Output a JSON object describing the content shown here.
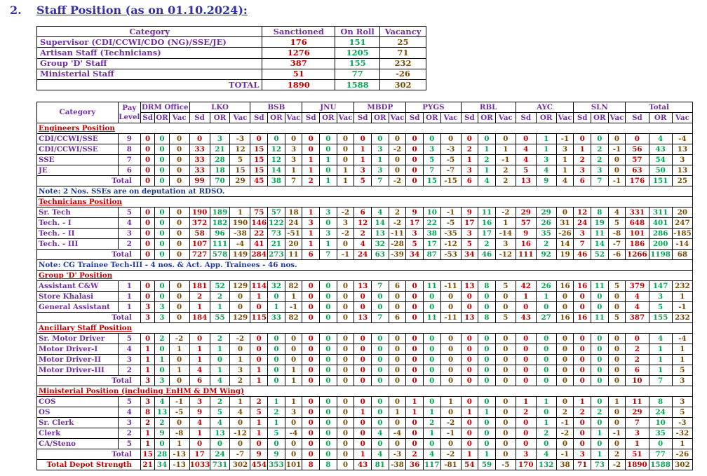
{
  "heading": {
    "number": "2.",
    "title": "Staff Position (as on 01.10.2024):"
  },
  "summary": {
    "headers": [
      "Category",
      "Sanctioned",
      "On Roll",
      "Vacancy"
    ],
    "rows": [
      {
        "category": "Supervisor (CDI/CCWI/CDO (NG)/SSE/JE)",
        "sanctioned": "176",
        "on_roll": "151",
        "vacancy": "25"
      },
      {
        "category": "Artisan Staff (Technicians)",
        "sanctioned": "1276",
        "on_roll": "1205",
        "vacancy": "71"
      },
      {
        "category": "Group 'D' Staff",
        "sanctioned": "387",
        "on_roll": "155",
        "vacancy": "232"
      },
      {
        "category": "Ministerial Staff",
        "sanctioned": "51",
        "on_roll": "77",
        "vacancy": "-26"
      }
    ],
    "total": {
      "label": "TOTAL",
      "sanctioned": "1890",
      "on_roll": "1588",
      "vacancy": "302"
    }
  },
  "detail": {
    "category_header": "Category",
    "pay_level_header": "Pay Level",
    "locations": [
      "DRM Office",
      "LKO",
      "BSB",
      "JNU",
      "MBDP",
      "PYGS",
      "RBL",
      "AYC",
      "SLN",
      "Total"
    ],
    "sub_headers": [
      "Sd",
      "OR",
      "Vac"
    ],
    "rows": [
      {
        "type": "section",
        "label": "Engineers Position"
      },
      {
        "type": "data",
        "label": "CDI/CCWI/SSE",
        "pay": "9",
        "values": [
          "0",
          "0",
          "0",
          "0",
          "3",
          "-3",
          "0",
          "0",
          "0",
          "0",
          "0",
          "0",
          "0",
          "0",
          "0",
          "0",
          "0",
          "0",
          "0",
          "0",
          "0",
          "0",
          "1",
          "-1",
          "0",
          "0",
          "0",
          "0",
          "4",
          "-4"
        ]
      },
      {
        "type": "data",
        "label": "CDI/CCWI/SSE",
        "pay": "8",
        "values": [
          "0",
          "0",
          "0",
          "33",
          "21",
          "12",
          "15",
          "12",
          "3",
          "0",
          "0",
          "0",
          "1",
          "3",
          "-2",
          "0",
          "3",
          "-3",
          "2",
          "1",
          "1",
          "4",
          "1",
          "3",
          "1",
          "2",
          "-1",
          "56",
          "43",
          "13"
        ]
      },
      {
        "type": "data",
        "label": "SSE",
        "pay": "7",
        "values": [
          "0",
          "0",
          "0",
          "33",
          "28",
          "5",
          "15",
          "12",
          "3",
          "1",
          "1",
          "0",
          "1",
          "1",
          "0",
          "0",
          "5",
          "-5",
          "1",
          "2",
          "-1",
          "4",
          "3",
          "1",
          "2",
          "2",
          "0",
          "57",
          "54",
          "3"
        ]
      },
      {
        "type": "data",
        "label": "JE",
        "pay": "6",
        "values": [
          "0",
          "0",
          "0",
          "33",
          "18",
          "15",
          "15",
          "14",
          "1",
          "1",
          "0",
          "1",
          "3",
          "3",
          "0",
          "0",
          "7",
          "-7",
          "3",
          "1",
          "2",
          "5",
          "4",
          "1",
          "3",
          "3",
          "0",
          "63",
          "50",
          "13"
        ]
      },
      {
        "type": "total",
        "label": "Total",
        "values": [
          "0",
          "0",
          "0",
          "99",
          "70",
          "29",
          "45",
          "38",
          "7",
          "2",
          "1",
          "1",
          "5",
          "7",
          "-2",
          "0",
          "15",
          "-15",
          "6",
          "4",
          "2",
          "13",
          "9",
          "4",
          "6",
          "7",
          "-1",
          "176",
          "151",
          "25"
        ]
      },
      {
        "type": "note",
        "label": "Note: 2 Nos. SSEs are on deputation at RDSO."
      },
      {
        "type": "section",
        "label": "Technicians Position"
      },
      {
        "type": "data",
        "label": "Sr. Tech",
        "pay": "5",
        "values": [
          "0",
          "0",
          "0",
          "190",
          "189",
          "1",
          "75",
          "57",
          "18",
          "1",
          "3",
          "-2",
          "6",
          "4",
          "2",
          "9",
          "10",
          "-1",
          "9",
          "11",
          "-2",
          "29",
          "29",
          "0",
          "12",
          "8",
          "4",
          "331",
          "311",
          "20"
        ]
      },
      {
        "type": "data",
        "label": "Tech. - I",
        "pay": "4",
        "values": [
          "0",
          "0",
          "0",
          "372",
          "182",
          "190",
          "146",
          "122",
          "24",
          "3",
          "0",
          "3",
          "12",
          "14",
          "-2",
          "17",
          "22",
          "-5",
          "17",
          "16",
          "1",
          "57",
          "26",
          "31",
          "24",
          "19",
          "5",
          "648",
          "401",
          "247"
        ]
      },
      {
        "type": "data",
        "label": "Tech. - II",
        "pay": "3",
        "values": [
          "0",
          "0",
          "0",
          "58",
          "96",
          "-38",
          "22",
          "73",
          "-51",
          "1",
          "3",
          "-2",
          "2",
          "13",
          "-11",
          "3",
          "38",
          "-35",
          "3",
          "17",
          "-14",
          "9",
          "35",
          "-26",
          "3",
          "11",
          "-8",
          "101",
          "286",
          "-185"
        ]
      },
      {
        "type": "data",
        "label": "Tech. - III",
        "pay": "2",
        "values": [
          "0",
          "0",
          "0",
          "107",
          "111",
          "-4",
          "41",
          "21",
          "20",
          "1",
          "1",
          "0",
          "4",
          "32",
          "-28",
          "5",
          "17",
          "-12",
          "5",
          "2",
          "3",
          "16",
          "2",
          "14",
          "7",
          "14",
          "-7",
          "186",
          "200",
          "-14"
        ]
      },
      {
        "type": "total",
        "label": "Total",
        "values": [
          "0",
          "0",
          "0",
          "727",
          "578",
          "149",
          "284",
          "273",
          "11",
          "6",
          "7",
          "-1",
          "24",
          "63",
          "-39",
          "34",
          "87",
          "-53",
          "34",
          "46",
          "-12",
          "111",
          "92",
          "19",
          "46",
          "52",
          "-6",
          "1266",
          "1198",
          "68"
        ]
      },
      {
        "type": "note",
        "label": "Note: CG Trainee Tech-III - 4 nos. & Act. App. Trainees - 46 nos."
      },
      {
        "type": "section",
        "label": "Group 'D' Position"
      },
      {
        "type": "data",
        "label": "Assistant C&W",
        "pay": "1",
        "values": [
          "0",
          "0",
          "0",
          "181",
          "52",
          "129",
          "114",
          "32",
          "82",
          "0",
          "0",
          "0",
          "13",
          "7",
          "6",
          "0",
          "11",
          "-11",
          "13",
          "8",
          "5",
          "42",
          "26",
          "16",
          "16",
          "11",
          "5",
          "379",
          "147",
          "232"
        ]
      },
      {
        "type": "data",
        "label": "Store Khalasi",
        "pay": "1",
        "values": [
          "0",
          "0",
          "0",
          "2",
          "2",
          "0",
          "1",
          "0",
          "1",
          "0",
          "0",
          "0",
          "0",
          "0",
          "0",
          "0",
          "0",
          "0",
          "0",
          "0",
          "0",
          "1",
          "1",
          "0",
          "0",
          "0",
          "0",
          "4",
          "3",
          "1"
        ]
      },
      {
        "type": "data",
        "label": "General Assistant",
        "pay": "1",
        "values": [
          "3",
          "3",
          "0",
          "1",
          "1",
          "0",
          "0",
          "1",
          "-1",
          "0",
          "0",
          "0",
          "0",
          "0",
          "0",
          "0",
          "0",
          "0",
          "0",
          "0",
          "0",
          "0",
          "0",
          "0",
          "0",
          "0",
          "0",
          "4",
          "5",
          "-1"
        ]
      },
      {
        "type": "total",
        "label": "Total",
        "values": [
          "3",
          "3",
          "0",
          "184",
          "55",
          "129",
          "115",
          "33",
          "82",
          "0",
          "0",
          "0",
          "13",
          "7",
          "6",
          "0",
          "11",
          "-11",
          "13",
          "8",
          "5",
          "43",
          "27",
          "16",
          "16",
          "11",
          "5",
          "387",
          "155",
          "232"
        ]
      },
      {
        "type": "section",
        "label": "Ancillary Staff Position"
      },
      {
        "type": "data",
        "label": "Sr. Motor Driver",
        "pay": "5",
        "values": [
          "0",
          "2",
          "-2",
          "0",
          "2",
          "-2",
          "0",
          "0",
          "0",
          "0",
          "0",
          "0",
          "0",
          "0",
          "0",
          "0",
          "0",
          "0",
          "0",
          "0",
          "0",
          "0",
          "0",
          "0",
          "0",
          "0",
          "0",
          "0",
          "4",
          "-4"
        ]
      },
      {
        "type": "data",
        "label": "Motor Driver-I",
        "pay": "4",
        "values": [
          "1",
          "0",
          "1",
          "1",
          "1",
          "0",
          "0",
          "0",
          "0",
          "0",
          "0",
          "0",
          "0",
          "0",
          "0",
          "0",
          "0",
          "0",
          "0",
          "0",
          "0",
          "0",
          "0",
          "0",
          "0",
          "0",
          "0",
          "2",
          "1",
          "1"
        ]
      },
      {
        "type": "data",
        "label": "Motor Driver-II",
        "pay": "3",
        "values": [
          "1",
          "1",
          "0",
          "1",
          "0",
          "1",
          "0",
          "0",
          "0",
          "0",
          "0",
          "0",
          "0",
          "0",
          "0",
          "0",
          "0",
          "0",
          "0",
          "0",
          "0",
          "0",
          "0",
          "0",
          "0",
          "0",
          "0",
          "2",
          "1",
          "1"
        ]
      },
      {
        "type": "data",
        "label": "Motor Driver-III",
        "pay": "2",
        "values": [
          "1",
          "0",
          "1",
          "4",
          "1",
          "3",
          "1",
          "0",
          "1",
          "0",
          "0",
          "0",
          "0",
          "0",
          "0",
          "0",
          "0",
          "0",
          "0",
          "0",
          "0",
          "0",
          "0",
          "0",
          "0",
          "0",
          "0",
          "6",
          "1",
          "5"
        ]
      },
      {
        "type": "total",
        "label": "Total",
        "values": [
          "3",
          "3",
          "0",
          "6",
          "4",
          "2",
          "1",
          "0",
          "1",
          "0",
          "0",
          "0",
          "0",
          "0",
          "0",
          "0",
          "0",
          "0",
          "0",
          "0",
          "0",
          "0",
          "0",
          "0",
          "0",
          "0",
          "0",
          "10",
          "7",
          "3"
        ]
      },
      {
        "type": "section",
        "label": "Ministerial Position (including EnHM & DM Wing)"
      },
      {
        "type": "data",
        "label": "COS",
        "pay": "5",
        "values": [
          "3",
          "4",
          "-1",
          "3",
          "2",
          "1",
          "2",
          "1",
          "1",
          "0",
          "0",
          "0",
          "0",
          "0",
          "0",
          "1",
          "0",
          "1",
          "0",
          "0",
          "0",
          "1",
          "1",
          "0",
          "1",
          "0",
          "1",
          "11",
          "8",
          "3"
        ]
      },
      {
        "type": "data",
        "label": "OS",
        "pay": "4",
        "values": [
          "8",
          "13",
          "-5",
          "9",
          "5",
          "4",
          "5",
          "2",
          "3",
          "0",
          "0",
          "0",
          "1",
          "0",
          "1",
          "1",
          "1",
          "0",
          "1",
          "1",
          "0",
          "2",
          "0",
          "2",
          "2",
          "2",
          "0",
          "29",
          "24",
          "5"
        ]
      },
      {
        "type": "data",
        "label": "Sr. Clerk",
        "pay": "3",
        "values": [
          "2",
          "2",
          "0",
          "4",
          "4",
          "0",
          "1",
          "1",
          "0",
          "0",
          "0",
          "0",
          "0",
          "0",
          "0",
          "0",
          "2",
          "-2",
          "0",
          "0",
          "0",
          "0",
          "1",
          "-1",
          "0",
          "0",
          "0",
          "7",
          "10",
          "-3"
        ]
      },
      {
        "type": "data",
        "label": "Clerk",
        "pay": "2",
        "values": [
          "1",
          "9",
          "-8",
          "1",
          "13",
          "-12",
          "1",
          "5",
          "-4",
          "0",
          "0",
          "0",
          "0",
          "4",
          "-4",
          "0",
          "1",
          "-1",
          "0",
          "0",
          "0",
          "0",
          "2",
          "-2",
          "0",
          "1",
          "-1",
          "3",
          "35",
          "-32"
        ]
      },
      {
        "type": "data",
        "label": "CA/Steno",
        "pay": "5",
        "values": [
          "1",
          "0",
          "1",
          "0",
          "0",
          "0",
          "0",
          "0",
          "0",
          "0",
          "0",
          "0",
          "0",
          "0",
          "0",
          "0",
          "0",
          "0",
          "0",
          "0",
          "0",
          "0",
          "0",
          "0",
          "0",
          "0",
          "0",
          "1",
          "0",
          "1"
        ]
      },
      {
        "type": "total",
        "label": "Total",
        "values": [
          "15",
          "28",
          "-13",
          "17",
          "24",
          "-7",
          "9",
          "9",
          "0",
          "0",
          "0",
          "0",
          "1",
          "4",
          "-3",
          "2",
          "4",
          "-2",
          "1",
          "1",
          "0",
          "3",
          "4",
          "-1",
          "3",
          "1",
          "2",
          "51",
          "77",
          "-26"
        ]
      },
      {
        "type": "grand",
        "label": "Total Depot Strength",
        "values": [
          "21",
          "34",
          "-13",
          "1033",
          "731",
          "302",
          "454",
          "353",
          "101",
          "8",
          "8",
          "0",
          "43",
          "81",
          "-38",
          "36",
          "117",
          "-81",
          "54",
          "59",
          "-5",
          "170",
          "132",
          "38",
          "71",
          "73",
          "-2",
          "1890",
          "1588",
          "302"
        ]
      }
    ]
  }
}
